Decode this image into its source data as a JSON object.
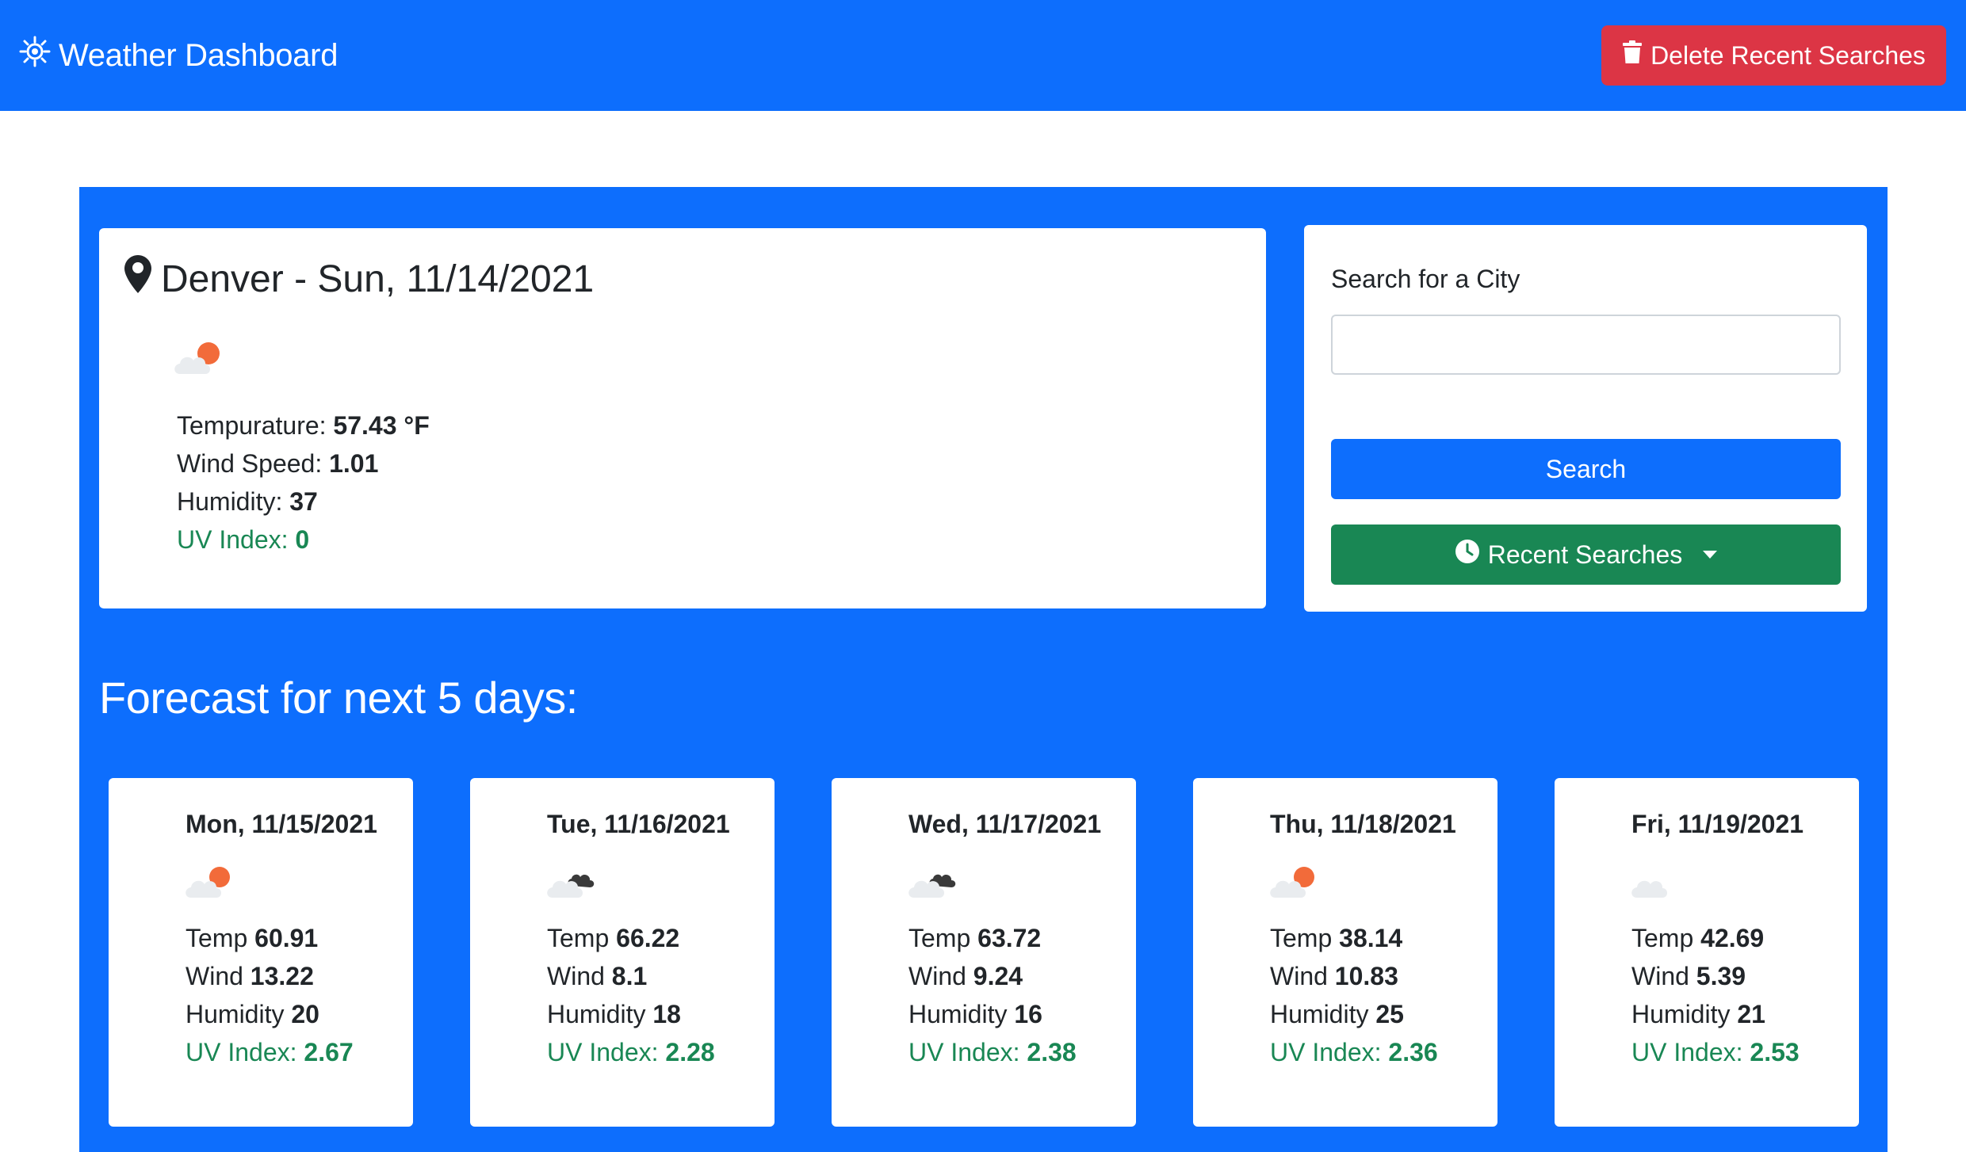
{
  "header": {
    "brand": "Weather Dashboard",
    "brand_icon": "sun-icon",
    "delete_label": "Delete Recent Searches",
    "delete_icon": "trash-icon",
    "bg_color": "#0d6efd",
    "delete_color": "#dc3545"
  },
  "current": {
    "title": "Denver - Sun, 11/14/2021",
    "location_icon": "map-pin-icon",
    "weather_icon": "partly-cloudy-day-icon",
    "temp_label": "Tempurature:",
    "temp_value": "57.43 °F",
    "wind_label": "Wind Speed:",
    "wind_value": "1.01",
    "humidity_label": "Humidity:",
    "humidity_value": "37",
    "uv_label": "UV Index:",
    "uv_value": "0"
  },
  "search": {
    "label": "Search for a City",
    "input_value": "",
    "placeholder": "",
    "button_label": "Search",
    "recent_label": "Recent Searches",
    "recent_icon": "clock-icon"
  },
  "forecast": {
    "title": "Forecast for next 5 days:",
    "temp_label": "Temp",
    "wind_label": "Wind",
    "humidity_label": "Humidity",
    "uv_label": "UV Index:",
    "days": [
      {
        "date": "Mon, 11/15/2021",
        "icon": "partly-cloudy-day-icon",
        "temp": "60.91",
        "wind": "13.22",
        "humidity": "20",
        "uv": "2.67"
      },
      {
        "date": "Tue, 11/16/2021",
        "icon": "broken-clouds-icon",
        "temp": "66.22",
        "wind": "8.1",
        "humidity": "18",
        "uv": "2.28"
      },
      {
        "date": "Wed, 11/17/2021",
        "icon": "broken-clouds-icon",
        "temp": "63.72",
        "wind": "9.24",
        "humidity": "16",
        "uv": "2.38"
      },
      {
        "date": "Thu, 11/18/2021",
        "icon": "partly-cloudy-day-icon",
        "temp": "38.14",
        "wind": "10.83",
        "humidity": "25",
        "uv": "2.36"
      },
      {
        "date": "Fri, 11/19/2021",
        "icon": "cloud-icon",
        "temp": "42.69",
        "wind": "5.39",
        "humidity": "21",
        "uv": "2.53"
      }
    ]
  }
}
